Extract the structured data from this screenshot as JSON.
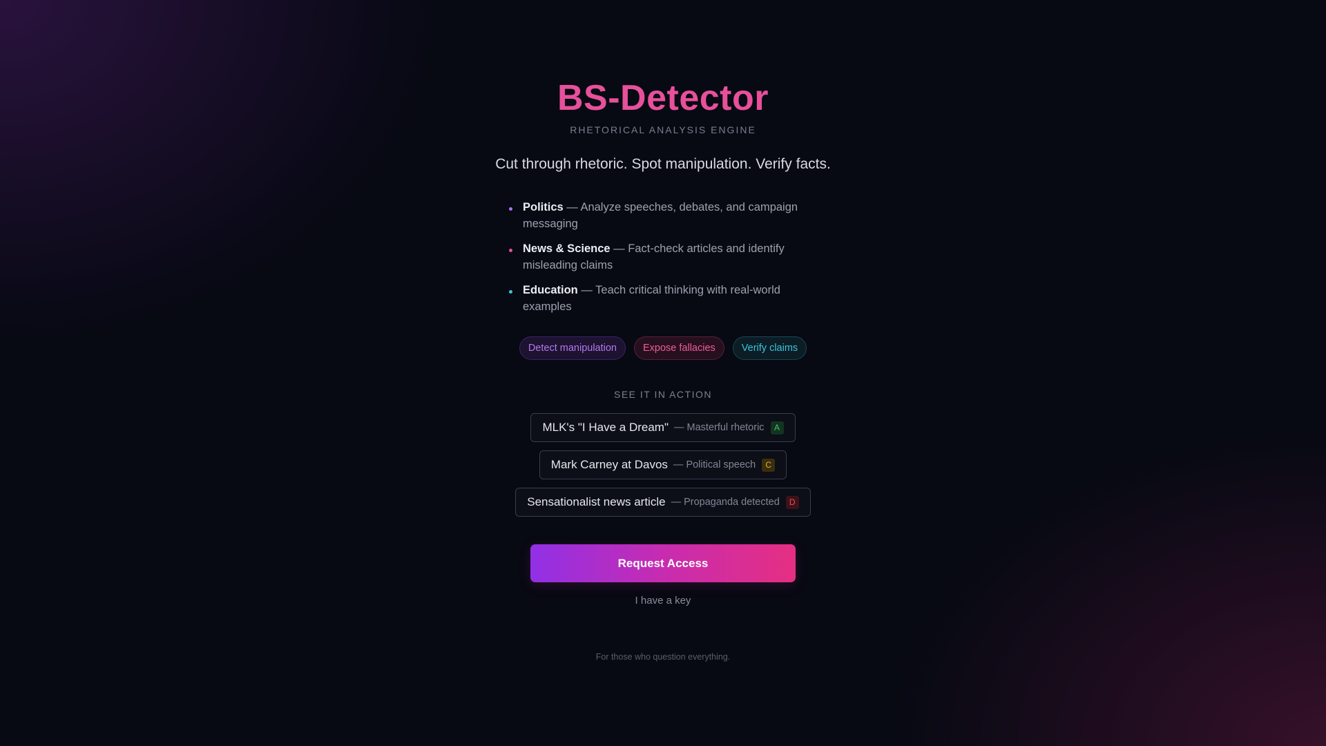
{
  "header": {
    "title": "BS-Detector",
    "subtitle": "RHETORICAL ANALYSIS ENGINE",
    "tagline": "Cut through rhetoric. Spot manipulation. Verify facts."
  },
  "features": [
    {
      "name": "Politics",
      "description": " — Analyze speeches, debates, and campaign messaging",
      "dot_color": "#b26ff0"
    },
    {
      "name": "News & Science",
      "description": " — Fact-check articles and identify misleading claims",
      "dot_color": "#ec4f9c"
    },
    {
      "name": "Education",
      "description": " — Teach critical thinking with real-world examples",
      "dot_color": "#3cc4dc"
    }
  ],
  "chips": [
    {
      "label": "Detect manipulation",
      "color": "#b27af0"
    },
    {
      "label": "Expose fallacies",
      "color": "#ee5c9e"
    },
    {
      "label": "Verify claims",
      "color": "#3cc4dc"
    }
  ],
  "examples_section": {
    "label": "SEE IT IN ACTION",
    "items": [
      {
        "name": "MLK's \"I Have a Dream\"",
        "description": "— Masterful rhetoric",
        "grade": "A",
        "grade_color": "#45c26a"
      },
      {
        "name": "Mark Carney at Davos",
        "description": "— Political speech",
        "grade": "C",
        "grade_color": "#e0b330"
      },
      {
        "name": "Sensationalist news article",
        "description": "— Propaganda detected",
        "grade": "D",
        "grade_color": "#ec4d5e"
      }
    ]
  },
  "actions": {
    "primary_label": "Request Access",
    "secondary_label": "I have a key"
  },
  "footer": {
    "note": "For those who question everything."
  },
  "theme": {
    "accent_pink": "#ec4f9c",
    "accent_purple": "#9130e6",
    "background": "#070913"
  }
}
